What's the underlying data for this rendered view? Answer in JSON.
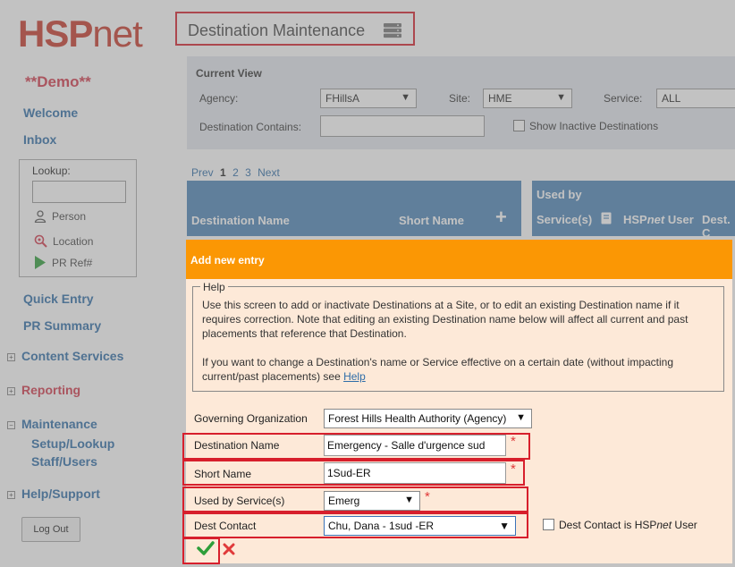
{
  "sidebar": {
    "logo_main": "HSP",
    "logo_suffix": "net",
    "demo": "**Demo**",
    "welcome": "Welcome",
    "inbox": "Inbox",
    "lookup_label": "Lookup:",
    "lookup_person": "Person",
    "lookup_location": "Location",
    "lookup_prref": "PR Ref#",
    "quick_entry": "Quick Entry",
    "pr_summary": "PR Summary",
    "content_services": "Content Services",
    "reporting": "Reporting",
    "maintenance": "Maintenance",
    "setup_lookup": "Setup/Lookup",
    "staff_users": "Staff/Users",
    "help_support": "Help/Support",
    "logout": "Log Out",
    "toggle_plus": "+",
    "toggle_minus": "−"
  },
  "page": {
    "title": "Destination Maintenance"
  },
  "current_view": {
    "title": "Current View",
    "agency_label": "Agency:",
    "agency_value": "FHillsA",
    "site_label": "Site:",
    "site_value": "HME",
    "service_label": "Service:",
    "service_value": "ALL",
    "dest_contains_label": "Destination Contains:",
    "dest_contains_value": "",
    "show_inactive_label": "Show Inactive Destinations"
  },
  "pager": {
    "prev": "Prev",
    "pages": [
      "1",
      "2",
      "3"
    ],
    "current": "1",
    "next": "Next"
  },
  "grid": {
    "col_destination_name": "Destination Name",
    "col_short_name": "Short Name",
    "add_symbol": "+",
    "used_by": "Used by",
    "col_services": "Service(s)",
    "col_hspnet_user_prefix": "HSP",
    "col_hspnet_user_italic": "net",
    "col_hspnet_user_suffix": " User",
    "col_dest": "Dest. C"
  },
  "dialog": {
    "header": "Add new entry",
    "help_legend": "Help",
    "help_para1": "Use this screen to add or inactivate Destinations at a Site, or to edit an existing Destination name if it requires correction.  Note that editing an existing Destination name below will affect all current and past placements that reference that Destination.",
    "help_para2_text": "If you want to change a Destination's name or Service effective on a certain date (without impacting current/past placements) see ",
    "help_para2_link": "Help",
    "gov_org_label": "Governing Organization",
    "gov_org_value": "Forest Hills Health Authority (Agency)",
    "dest_name_label": "Destination Name",
    "dest_name_value": "Emergency - Salle d'urgence sud",
    "short_name_label": "Short Name",
    "short_name_value": "1Sud-ER",
    "used_by_label": "Used by Service(s)",
    "used_by_value": "Emerg",
    "dest_contact_label": "Dest Contact",
    "dest_contact_value": "Chu, Dana - 1sud -ER",
    "dest_contact_is_user_prefix": "Dest Contact is HSP",
    "dest_contact_is_user_italic": "net",
    "dest_contact_is_user_suffix": " User",
    "required_marker": "*"
  },
  "icons": {
    "arrow_down": "▼",
    "confirm_color": "#2e9e3a",
    "cancel_color": "#e03a3a",
    "accent": "#fb9704",
    "highlight": "#d71f2c"
  }
}
